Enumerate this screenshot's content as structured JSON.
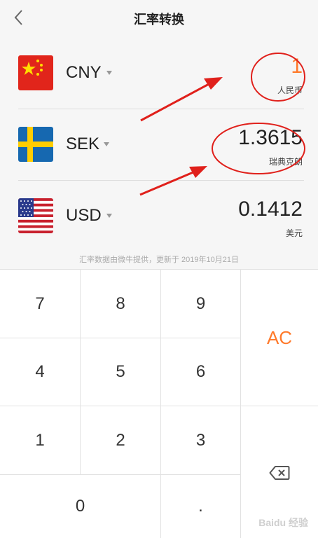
{
  "header": {
    "title": "汇率转换",
    "back_icon": "back-chevron-icon"
  },
  "currencies": [
    {
      "code": "CNY",
      "amount": "1",
      "name": "人民币",
      "flag": "china-flag-icon",
      "active": true
    },
    {
      "code": "SEK",
      "amount": "1.3615",
      "name": "瑞典克朗",
      "flag": "sweden-flag-icon",
      "active": false
    },
    {
      "code": "USD",
      "amount": "0.1412",
      "name": "美元",
      "flag": "usa-flag-icon",
      "active": false
    }
  ],
  "source_note": "汇率数据由微牛提供，更新于 2019年10月21日",
  "keypad": {
    "k7": "7",
    "k8": "8",
    "k9": "9",
    "k4": "4",
    "k5": "5",
    "k6": "6",
    "k1": "1",
    "k2": "2",
    "k3": "3",
    "k0": "0",
    "dot": ".",
    "clear": "AC",
    "backspace_icon": "backspace-icon"
  },
  "watermark": "Baidu 经验",
  "colors": {
    "accent": "#ff7a2b",
    "annotation": "#e0201b",
    "background": "#f6f6f6"
  }
}
